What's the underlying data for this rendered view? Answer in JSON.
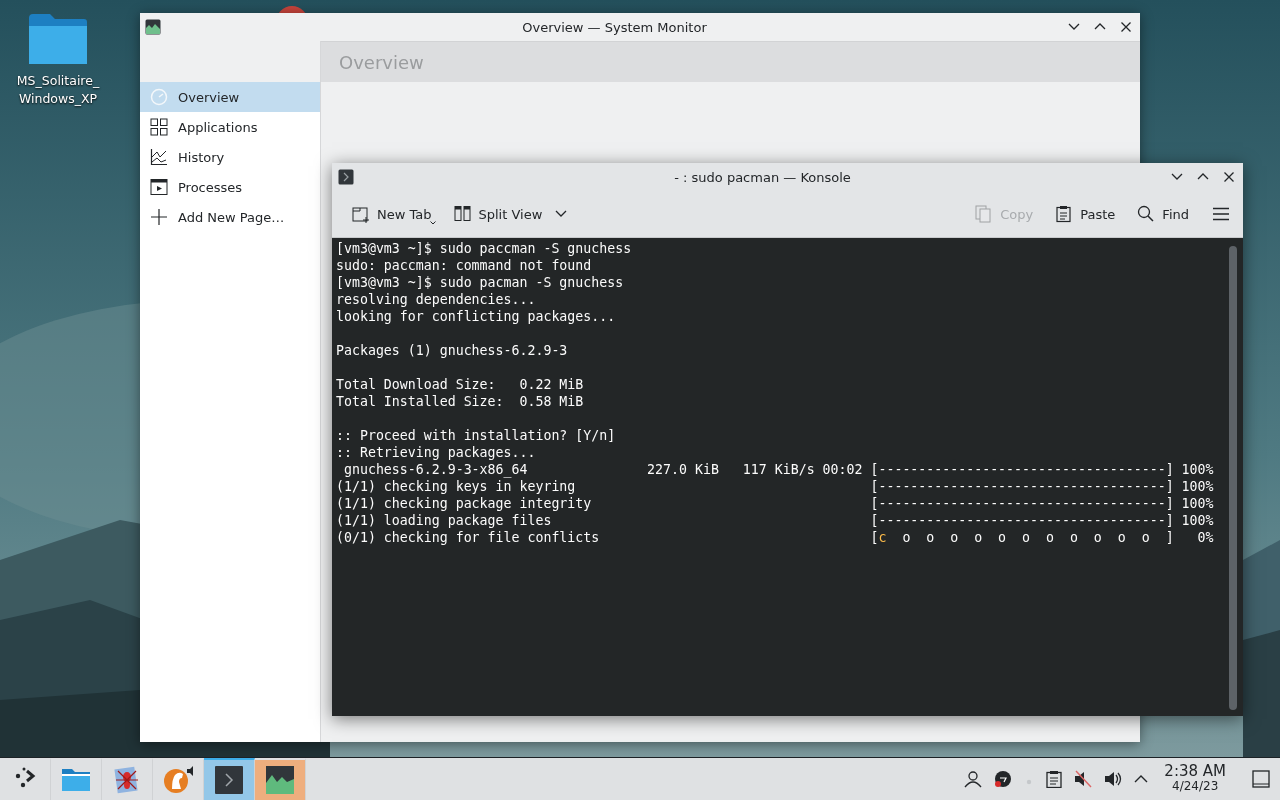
{
  "desktop": {
    "icons": [
      {
        "label_lines": [
          "MS_Solitaire_",
          "Windows_XP"
        ]
      }
    ]
  },
  "system_monitor": {
    "title": "Overview — System Monitor",
    "page_title": "Overview",
    "sidebar": {
      "items": [
        {
          "label": "Overview",
          "selected": true
        },
        {
          "label": "Applications",
          "selected": false
        },
        {
          "label": "History",
          "selected": false
        },
        {
          "label": "Processes",
          "selected": false
        },
        {
          "label": "Add New Page…",
          "selected": false
        }
      ]
    }
  },
  "konsole": {
    "title": "- : sudo pacman — Konsole",
    "toolbar": {
      "left": [
        {
          "label": "New Tab",
          "disabled": false
        },
        {
          "label": "Split View",
          "disabled": false
        }
      ],
      "right": [
        {
          "label": "Copy",
          "disabled": true
        },
        {
          "label": "Paste",
          "disabled": false
        },
        {
          "label": "Find",
          "disabled": false
        }
      ]
    },
    "terminal": {
      "blocks": [
        [
          "[vm3@vm3 ~]$ sudo paccman -S gnuchess",
          "sudo: paccman: command not found",
          "[vm3@vm3 ~]$ sudo pacman -S gnuchess",
          "resolving dependencies...",
          "looking for conflicting packages..."
        ],
        [
          "Packages (1) gnuchess-6.2.9-3"
        ],
        [
          "Total Download Size:   0.22 MiB",
          "Total Installed Size:  0.58 MiB"
        ],
        [
          ":: Proceed with installation? [Y/n]",
          ":: Retrieving packages...",
          " gnuchess-6.2.9-3-x86_64               227.0 KiB   117 KiB/s 00:02 [------------------------------------] 100%",
          "(1/1) checking keys in keyring                                     [------------------------------------] 100%",
          "(1/1) checking package integrity                                   [------------------------------------] 100%",
          "(1/1) loading package files                                        [------------------------------------] 100%",
          {
            "segments": [
              {
                "text": "(0/1) checking for file conflicts                                  ["
              },
              {
                "text": "c",
                "color": "#fdbc4b"
              },
              {
                "text": "  o  o  o  o  o  o  o  o  o  o  o  ]   0%"
              }
            ]
          }
        ]
      ]
    }
  },
  "taskbar": {
    "tasks": [
      {
        "selected": false,
        "attention": false
      },
      {
        "selected": false,
        "attention": false
      },
      {
        "selected": false,
        "attention": false
      },
      {
        "selected": false,
        "attention": false
      },
      {
        "selected": true,
        "attention": false
      },
      {
        "selected": false,
        "attention": true
      }
    ],
    "clock": {
      "time": "2:38 AM",
      "date": "4/24/23"
    }
  }
}
